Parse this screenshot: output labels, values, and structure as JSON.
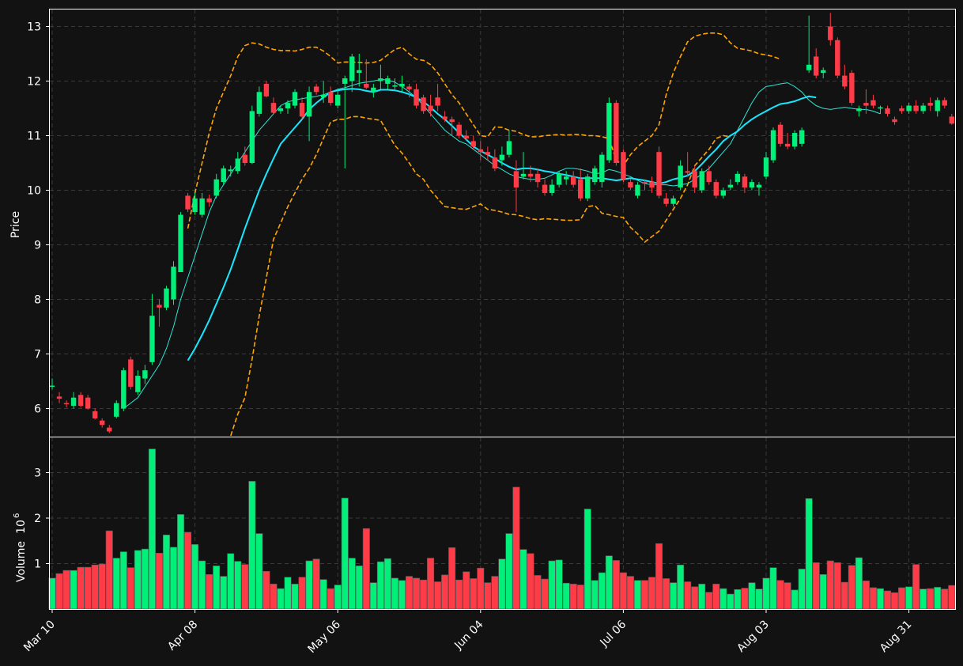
{
  "chart_data": {
    "type": "candlestick",
    "colors": {
      "background": "#121212",
      "up": "#00f07a",
      "down": "#ff3b47",
      "ma_fast": "#2ee6d6",
      "ma_slow": "#16e8ff",
      "bands": "#ffa500",
      "grid": "#3a3a3a",
      "text": "#ffffff"
    },
    "price_panel": {
      "ylabel": "Price",
      "yticks": [
        6,
        7,
        8,
        9,
        10,
        11,
        12,
        13
      ]
    },
    "volume_panel": {
      "ylabel": "Volume",
      "ylabel_exponent": "10",
      "ylabel_power": "6",
      "yticks": [
        1,
        2,
        3
      ]
    },
    "x_tick_labels": [
      {
        "i": 0,
        "label": "Mar 10"
      },
      {
        "i": 20,
        "label": "Apr 08"
      },
      {
        "i": 40,
        "label": "May 06"
      },
      {
        "i": 60,
        "label": "Jun 04"
      },
      {
        "i": 80,
        "label": "Jul 06"
      },
      {
        "i": 100,
        "label": "Aug 03"
      },
      {
        "i": 120,
        "label": "Aug 31"
      }
    ],
    "ohlc": [
      [
        6.4,
        6.55,
        6.35,
        6.42
      ],
      [
        6.22,
        6.3,
        6.1,
        6.18
      ],
      [
        6.1,
        6.15,
        6.02,
        6.08
      ],
      [
        6.05,
        6.3,
        6.0,
        6.2
      ],
      [
        6.25,
        6.3,
        6.02,
        6.05
      ],
      [
        6.2,
        6.25,
        5.98,
        6.0
      ],
      [
        5.95,
        6.0,
        5.8,
        5.82
      ],
      [
        5.78,
        5.82,
        5.65,
        5.7
      ],
      [
        5.65,
        5.7,
        5.55,
        5.58
      ],
      [
        5.85,
        6.15,
        5.82,
        6.1
      ],
      [
        6.0,
        6.75,
        5.95,
        6.7
      ],
      [
        6.9,
        6.95,
        6.35,
        6.4
      ],
      [
        6.3,
        6.7,
        6.25,
        6.6
      ],
      [
        6.55,
        6.8,
        6.45,
        6.7
      ],
      [
        6.85,
        8.1,
        6.8,
        7.7
      ],
      [
        7.9,
        8.0,
        7.5,
        7.85
      ],
      [
        7.85,
        8.25,
        7.8,
        8.2
      ],
      [
        8.0,
        8.7,
        7.9,
        8.6
      ],
      [
        8.5,
        9.6,
        8.5,
        9.55
      ],
      [
        9.9,
        9.95,
        9.6,
        9.65
      ],
      [
        9.6,
        9.95,
        9.55,
        9.85
      ],
      [
        9.55,
        9.95,
        9.5,
        9.85
      ],
      [
        9.85,
        9.92,
        9.7,
        9.78
      ],
      [
        9.9,
        10.3,
        9.85,
        10.2
      ],
      [
        10.15,
        10.45,
        10.1,
        10.4
      ],
      [
        10.35,
        10.45,
        10.25,
        10.38
      ],
      [
        10.35,
        10.7,
        10.3,
        10.58
      ],
      [
        10.65,
        10.8,
        10.45,
        10.5
      ],
      [
        10.5,
        11.55,
        10.48,
        11.45
      ],
      [
        11.4,
        11.9,
        11.35,
        11.8
      ],
      [
        11.95,
        12.0,
        11.7,
        11.72
      ],
      [
        11.6,
        11.7,
        11.4,
        11.42
      ],
      [
        11.45,
        11.55,
        11.4,
        11.5
      ],
      [
        11.5,
        11.65,
        11.4,
        11.6
      ],
      [
        11.55,
        11.85,
        11.5,
        11.8
      ],
      [
        11.6,
        11.7,
        11.3,
        11.35
      ],
      [
        11.35,
        11.9,
        10.9,
        11.8
      ],
      [
        11.9,
        11.95,
        11.75,
        11.8
      ],
      [
        11.7,
        12.0,
        11.6,
        11.75
      ],
      [
        11.8,
        11.9,
        11.55,
        11.6
      ],
      [
        11.55,
        11.85,
        11.5,
        11.75
      ],
      [
        11.95,
        12.1,
        10.4,
        12.05
      ],
      [
        12.0,
        12.5,
        11.8,
        12.45
      ],
      [
        12.15,
        12.5,
        11.9,
        12.2
      ],
      [
        11.95,
        12.4,
        11.85,
        11.88
      ],
      [
        11.8,
        11.95,
        11.7,
        11.88
      ],
      [
        12.0,
        12.3,
        11.85,
        12.05
      ],
      [
        11.95,
        12.1,
        11.85,
        12.05
      ],
      [
        11.9,
        12.05,
        11.85,
        11.92
      ],
      [
        11.9,
        12.1,
        11.8,
        11.95
      ],
      [
        11.9,
        11.95,
        11.7,
        11.85
      ],
      [
        11.85,
        11.95,
        11.5,
        11.55
      ],
      [
        11.7,
        11.75,
        11.4,
        11.45
      ],
      [
        11.55,
        11.75,
        11.35,
        11.45
      ],
      [
        11.7,
        11.95,
        11.45,
        11.55
      ],
      [
        11.35,
        11.45,
        11.25,
        11.3
      ],
      [
        11.3,
        11.35,
        11.0,
        11.25
      ],
      [
        11.2,
        11.25,
        10.95,
        11.0
      ],
      [
        11.0,
        11.1,
        10.9,
        10.95
      ],
      [
        10.9,
        11.0,
        10.75,
        10.8
      ],
      [
        10.75,
        10.9,
        10.55,
        10.7
      ],
      [
        10.7,
        10.8,
        10.55,
        10.65
      ],
      [
        10.6,
        10.75,
        10.35,
        10.4
      ],
      [
        10.55,
        10.8,
        10.45,
        10.65
      ],
      [
        10.65,
        11.1,
        10.6,
        10.9
      ],
      [
        10.35,
        10.55,
        9.6,
        10.05
      ],
      [
        10.25,
        10.7,
        10.2,
        10.3
      ],
      [
        10.3,
        10.45,
        10.15,
        10.25
      ],
      [
        10.3,
        10.4,
        10.05,
        10.15
      ],
      [
        10.1,
        10.2,
        9.9,
        9.95
      ],
      [
        9.95,
        10.2,
        9.9,
        10.1
      ],
      [
        10.1,
        10.35,
        10.05,
        10.3
      ],
      [
        10.2,
        10.35,
        10.1,
        10.25
      ],
      [
        10.25,
        10.35,
        10.05,
        10.1
      ],
      [
        10.2,
        10.4,
        9.8,
        9.85
      ],
      [
        9.85,
        10.3,
        9.8,
        10.25
      ],
      [
        10.15,
        10.45,
        10.1,
        10.4
      ],
      [
        10.15,
        10.7,
        10.05,
        10.65
      ],
      [
        10.55,
        11.7,
        10.5,
        11.6
      ],
      [
        11.6,
        11.65,
        10.45,
        10.5
      ],
      [
        10.7,
        10.75,
        10.15,
        10.2
      ],
      [
        10.15,
        10.2,
        10.0,
        10.05
      ],
      [
        9.9,
        10.15,
        9.85,
        10.1
      ],
      [
        10.15,
        10.2,
        10.0,
        10.12
      ],
      [
        10.15,
        10.25,
        9.95,
        10.05
      ],
      [
        10.7,
        10.8,
        9.85,
        9.9
      ],
      [
        9.85,
        9.95,
        9.7,
        9.75
      ],
      [
        9.75,
        9.9,
        9.7,
        9.85
      ],
      [
        10.05,
        10.55,
        10.0,
        10.45
      ],
      [
        10.35,
        10.7,
        10.25,
        10.32
      ],
      [
        10.35,
        10.45,
        9.95,
        10.05
      ],
      [
        10.0,
        10.4,
        9.95,
        10.35
      ],
      [
        10.35,
        10.45,
        10.1,
        10.15
      ],
      [
        10.15,
        10.2,
        9.85,
        9.9
      ],
      [
        9.9,
        10.05,
        9.85,
        10.0
      ],
      [
        10.05,
        10.2,
        10.0,
        10.1
      ],
      [
        10.15,
        10.35,
        10.1,
        10.3
      ],
      [
        10.25,
        10.3,
        9.95,
        10.05
      ],
      [
        10.05,
        10.2,
        10.0,
        10.15
      ],
      [
        10.05,
        10.15,
        9.9,
        10.1
      ],
      [
        10.25,
        10.7,
        10.2,
        10.6
      ],
      [
        10.55,
        11.15,
        10.5,
        11.1
      ],
      [
        11.2,
        11.25,
        10.8,
        10.85
      ],
      [
        10.85,
        11.05,
        10.75,
        10.8
      ],
      [
        10.8,
        11.1,
        10.75,
        11.05
      ],
      [
        10.85,
        11.15,
        10.8,
        11.1
      ],
      [
        12.2,
        13.2,
        12.15,
        12.3
      ],
      [
        12.45,
        12.6,
        12.05,
        12.1
      ],
      [
        12.15,
        12.25,
        12.05,
        12.2
      ],
      [
        13.0,
        13.25,
        12.65,
        12.75
      ],
      [
        12.75,
        12.8,
        12.05,
        12.1
      ],
      [
        12.1,
        12.3,
        11.85,
        11.9
      ],
      [
        12.15,
        12.2,
        11.55,
        11.6
      ],
      [
        11.45,
        11.55,
        11.35,
        11.5
      ],
      [
        11.6,
        11.85,
        11.4,
        11.55
      ],
      [
        11.65,
        11.75,
        11.5,
        11.55
      ],
      [
        11.5,
        11.55,
        11.4,
        11.52
      ],
      [
        11.5,
        11.55,
        11.35,
        11.4
      ],
      [
        11.3,
        11.35,
        11.2,
        11.25
      ],
      [
        11.5,
        11.55,
        11.4,
        11.45
      ],
      [
        11.45,
        11.6,
        11.4,
        11.55
      ],
      [
        11.55,
        11.65,
        11.4,
        11.45
      ],
      [
        11.45,
        11.6,
        11.4,
        11.55
      ],
      [
        11.6,
        11.7,
        11.45,
        11.55
      ],
      [
        11.45,
        11.7,
        11.35,
        11.65
      ],
      [
        11.65,
        11.7,
        11.5,
        11.55
      ],
      [
        11.35,
        11.4,
        11.2,
        11.22
      ]
    ],
    "volume_millions": [
      0.68,
      0.78,
      0.85,
      0.85,
      0.92,
      0.92,
      0.97,
      0.99,
      1.72,
      1.12,
      1.26,
      0.91,
      1.29,
      1.32,
      3.52,
      1.23,
      1.63,
      1.36,
      2.08,
      1.69,
      1.42,
      1.06,
      0.76,
      0.95,
      0.72,
      1.22,
      1.05,
      0.98,
      2.81,
      1.66,
      0.83,
      0.55,
      0.45,
      0.7,
      0.55,
      0.7,
      1.06,
      1.1,
      0.65,
      0.45,
      0.53,
      2.44,
      1.12,
      0.95,
      1.77,
      0.58,
      1.04,
      1.11,
      0.68,
      0.63,
      0.72,
      0.68,
      0.64,
      1.12,
      0.6,
      0.75,
      1.35,
      0.64,
      0.82,
      0.67,
      0.9,
      0.58,
      0.72,
      1.1,
      1.66,
      2.68,
      1.31,
      1.22,
      0.74,
      0.66,
      1.06,
      1.08,
      0.57,
      0.55,
      0.53,
      2.2,
      0.63,
      0.8,
      1.17,
      1.07,
      0.8,
      0.72,
      0.63,
      0.63,
      0.7,
      1.44,
      0.67,
      0.58,
      0.97,
      0.6,
      0.49,
      0.55,
      0.37,
      0.55,
      0.45,
      0.33,
      0.43,
      0.46,
      0.58,
      0.44,
      0.68,
      0.91,
      0.63,
      0.58,
      0.42,
      0.88,
      2.43,
      1.02,
      0.76,
      1.06,
      1.02,
      0.59,
      0.96,
      1.13,
      0.62,
      0.47,
      0.45,
      0.4,
      0.36,
      0.47,
      0.49,
      0.98,
      0.44,
      0.45,
      0.48,
      0.44,
      0.52
    ],
    "ma_fast": [
      {
        "from": 10,
        "values": [
          6.0,
          6.1,
          6.2,
          6.4,
          6.6,
          6.8,
          7.1,
          7.5,
          8.0,
          8.4,
          8.8,
          9.2,
          9.6,
          9.9,
          10.1,
          10.3,
          10.5,
          10.7,
          10.9,
          11.1,
          11.25,
          11.4,
          11.55,
          11.62,
          11.65,
          11.68,
          11.7,
          11.72,
          11.75,
          11.8,
          11.85,
          11.88,
          11.92,
          11.96,
          11.98,
          12.0,
          12.03,
          12.02,
          11.98,
          11.9,
          11.8,
          11.7,
          11.55,
          11.4,
          11.25,
          11.1,
          11.0,
          10.9,
          10.85,
          10.75,
          10.65,
          10.55,
          10.45,
          10.38,
          10.3,
          10.25,
          10.22,
          10.2,
          10.2,
          10.22,
          10.28,
          10.35,
          10.4,
          10.4,
          10.38,
          10.35,
          10.3,
          10.32,
          10.38,
          10.35,
          10.3,
          10.25,
          10.18,
          10.12,
          10.1,
          10.1,
          10.1,
          10.08,
          10.1,
          10.12,
          10.2,
          10.3,
          10.4,
          10.55,
          10.7,
          10.85,
          11.1,
          11.35,
          11.6,
          11.8,
          11.9,
          11.92,
          11.95,
          11.97,
          11.9,
          11.8,
          11.65,
          11.55,
          11.5,
          11.48,
          11.5,
          11.52,
          11.5,
          11.48,
          11.48,
          11.45,
          11.4
        ]
      }
    ],
    "ma_slow": [
      {
        "from": 19,
        "values": [
          6.88,
          7.1,
          7.35,
          7.62,
          7.92,
          8.22,
          8.55,
          8.92,
          9.3,
          9.65,
          10.0,
          10.3,
          10.58,
          10.85,
          11.0,
          11.15,
          11.3,
          11.48,
          11.6,
          11.7,
          11.8,
          11.83,
          11.85,
          11.86,
          11.85,
          11.82,
          11.8,
          11.84,
          11.84,
          11.83,
          11.8,
          11.76,
          11.7,
          11.62,
          11.52,
          11.4,
          11.3,
          11.18,
          11.05,
          10.93,
          10.8,
          10.72,
          10.65,
          10.58,
          10.5,
          10.43,
          10.38,
          10.4,
          10.4,
          10.38,
          10.35,
          10.33,
          10.3,
          10.28,
          10.25,
          10.22,
          10.22,
          10.22,
          10.22,
          10.2,
          10.18,
          10.2,
          10.22,
          10.2,
          10.18,
          10.15,
          10.12,
          10.15,
          10.2,
          10.23,
          10.27,
          10.35,
          10.48,
          10.62,
          10.75,
          10.9,
          11.0,
          11.08,
          11.2,
          11.3,
          11.38,
          11.45,
          11.52,
          11.58,
          11.6,
          11.63,
          11.68,
          11.72,
          11.7
        ]
      }
    ],
    "bollinger_upper": [
      {
        "from": 19,
        "values": [
          9.3,
          9.95,
          10.5,
          11.05,
          11.5,
          11.8,
          12.1,
          12.45,
          12.65,
          12.7,
          12.68,
          12.62,
          12.58,
          12.56,
          12.56,
          12.55,
          12.58,
          12.62,
          12.62,
          12.55,
          12.45,
          12.33,
          12.35,
          12.35,
          12.34,
          12.33,
          12.34,
          12.38,
          12.48,
          12.58,
          12.62,
          12.5,
          12.4,
          12.38,
          12.3,
          12.15,
          11.95,
          11.75,
          11.6,
          11.4,
          11.2,
          11.0,
          10.98,
          11.16,
          11.15,
          11.1,
          11.08,
          11.02,
          10.98,
          10.98,
          11.0,
          11.01,
          11.02,
          11.01,
          11.02,
          11.02,
          11.0,
          11.0,
          10.98,
          10.95,
          10.55,
          10.45,
          10.65,
          10.8,
          10.9,
          11.0,
          11.2,
          11.75,
          12.15,
          12.45,
          12.72,
          12.82,
          12.86,
          12.88,
          12.88,
          12.85,
          12.7,
          12.6,
          12.58,
          12.55,
          12.5,
          12.48,
          12.45,
          12.4
        ]
      }
    ],
    "bollinger_lower": [
      {
        "from": 25,
        "values": [
          5.5,
          5.9,
          6.2,
          6.9,
          7.7,
          8.4,
          9.1,
          9.4,
          9.7,
          9.95,
          10.2,
          10.4,
          10.65,
          10.95,
          11.25,
          11.3,
          11.3,
          11.35,
          11.35,
          11.32,
          11.3,
          11.28,
          11.05,
          10.82,
          10.68,
          10.5,
          10.3,
          10.2,
          10.0,
          9.85,
          9.7,
          9.68,
          9.66,
          9.65,
          9.7,
          9.75,
          9.65,
          9.63,
          9.6,
          9.56,
          9.55,
          9.52,
          9.48,
          9.46,
          9.48,
          9.47,
          9.46,
          9.45,
          9.45,
          9.46,
          9.7,
          9.72,
          9.58,
          9.55,
          9.52,
          9.5,
          9.32,
          9.2,
          9.05,
          9.15,
          9.25,
          9.45,
          9.65,
          9.85,
          10.1,
          10.45,
          10.6,
          10.75,
          10.95,
          11.0,
          10.98
        ]
      }
    ]
  }
}
